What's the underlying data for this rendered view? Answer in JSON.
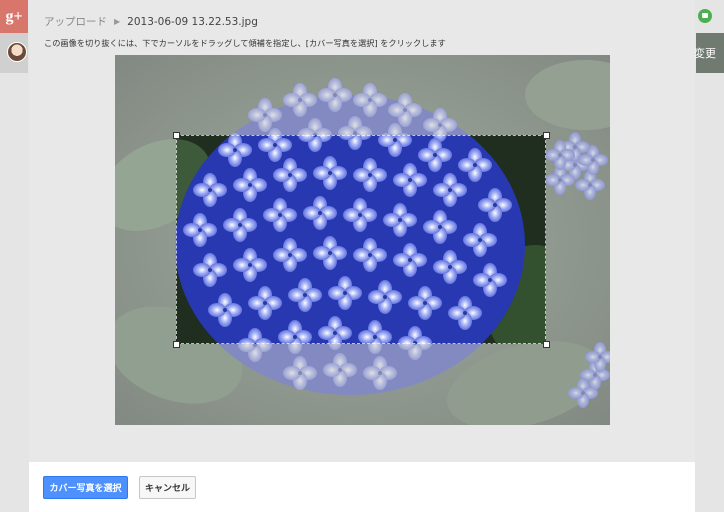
{
  "background": {
    "gplus_logo": "g+",
    "right_button_text": "変更"
  },
  "dialog": {
    "breadcrumb": {
      "parent": "アップロード",
      "separator_icon": "chevron-right-icon",
      "current_file": "2013-06-09 13.22.53.jpg"
    },
    "instruction": "この画像を切り抜くには、下でカーソルをドラッグして傾補を指定し、[カバー写真を選択] をクリックします",
    "image_alt": "hydrangea",
    "buttons": {
      "select": "カバー写真を選択",
      "cancel": "キャンセル"
    }
  },
  "colors": {
    "primary_button": "#4d90fe",
    "dialog_bg": "#e8e8e8",
    "gplus_red": "#d9766b"
  }
}
